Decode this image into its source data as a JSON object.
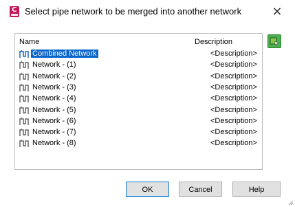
{
  "window": {
    "title": "Select pipe network to be merged into another network",
    "close_glyph": "×",
    "app_icon": "civil3d-app-icon"
  },
  "list": {
    "headers": {
      "name": "Name",
      "description": "Description"
    },
    "items": [
      {
        "name": "Combined Network",
        "description": "<Description>",
        "selected": true
      },
      {
        "name": "Network - (1)",
        "description": "<Description>"
      },
      {
        "name": "Network - (2)",
        "description": "<Description>"
      },
      {
        "name": "Network - (3)",
        "description": "<Description>"
      },
      {
        "name": "Network - (4)",
        "description": "<Description>"
      },
      {
        "name": "Network - (5)",
        "description": "<Description>"
      },
      {
        "name": "Network - (6)",
        "description": "<Description>"
      },
      {
        "name": "Network - (7)",
        "description": "<Description>"
      },
      {
        "name": "Network - (8)",
        "description": "<Description>"
      }
    ]
  },
  "buttons": {
    "ok": "OK",
    "cancel": "Cancel",
    "help": "Help"
  },
  "colors": {
    "selection": "#0a64c9",
    "accent_button": "#4caf50",
    "app_icon": "#c2185b"
  }
}
